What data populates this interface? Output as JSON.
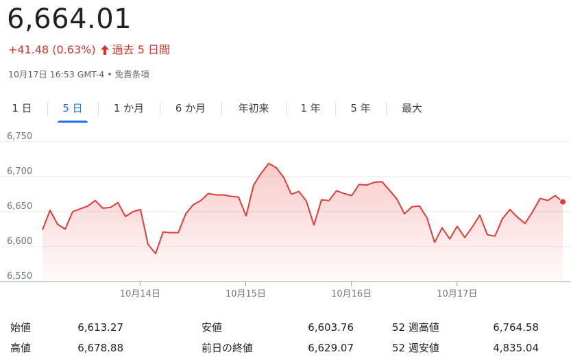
{
  "header": {
    "price": "6,664.01",
    "change": "+41.48 (0.63%)",
    "change_period": "過去 5 日間",
    "timestamp": "10月17日 16:53 GMT-4",
    "separator": "•",
    "disclaimer": "免責条項"
  },
  "tabs": [
    {
      "label": "1 日",
      "active": false
    },
    {
      "label": "5 日",
      "active": true
    },
    {
      "label": "1 か月",
      "active": false
    },
    {
      "label": "6 か月",
      "active": false
    },
    {
      "label": "年初来",
      "active": false
    },
    {
      "label": "1 年",
      "active": false
    },
    {
      "label": "5 年",
      "active": false
    },
    {
      "label": "最大",
      "active": false
    }
  ],
  "colors": {
    "line": "#e53935",
    "up": "#d93025",
    "active_tab": "#1a73e8",
    "grid": "#e8eaed",
    "axis_text": "#70757a"
  },
  "chart_data": {
    "type": "area",
    "y_ticks": [
      "6,750",
      "6,700",
      "6,650",
      "6,600",
      "6,550"
    ],
    "ylim": [
      6550,
      6750
    ],
    "x_labels": [
      {
        "label": "10月14日",
        "x": 12
      },
      {
        "label": "10月15日",
        "x": 25
      },
      {
        "label": "10月16日",
        "x": 38
      },
      {
        "label": "10月17日",
        "x": 51
      }
    ],
    "xlim": [
      0,
      64
    ],
    "grid": true,
    "series": [
      {
        "values": [
          6624,
          6652,
          6632,
          6625,
          6650,
          6654,
          6658,
          6666,
          6655,
          6656,
          6663,
          6643,
          6650,
          6653,
          6603,
          6590,
          6621,
          6620,
          6620,
          6647,
          6660,
          6666,
          6676,
          6674,
          6674,
          6672,
          6671,
          6644,
          6688,
          6705,
          6719,
          6713,
          6699,
          6675,
          6679,
          6665,
          6631,
          6667,
          6666,
          6680,
          6676,
          6673,
          6689,
          6688,
          6692,
          6693,
          6681,
          6668,
          6647,
          6657,
          6658,
          6641,
          6606,
          6627,
          6611,
          6629,
          6613,
          6628,
          6645,
          6617,
          6615,
          6640,
          6653,
          6642,
          6633,
          6650,
          6669,
          6666,
          6673,
          6664
        ]
      }
    ]
  },
  "stats": {
    "open_label": "始値",
    "open_value": "6,613.27",
    "high_label": "高値",
    "high_value": "6,678.88",
    "low_label": "安値",
    "low_value": "6,603.76",
    "prev_close_label": "前日の終値",
    "prev_close_value": "6,629.07",
    "wk52_high_label": "52 週高値",
    "wk52_high_value": "6,764.58",
    "wk52_low_label": "52 週安値",
    "wk52_low_value": "4,835.04"
  }
}
